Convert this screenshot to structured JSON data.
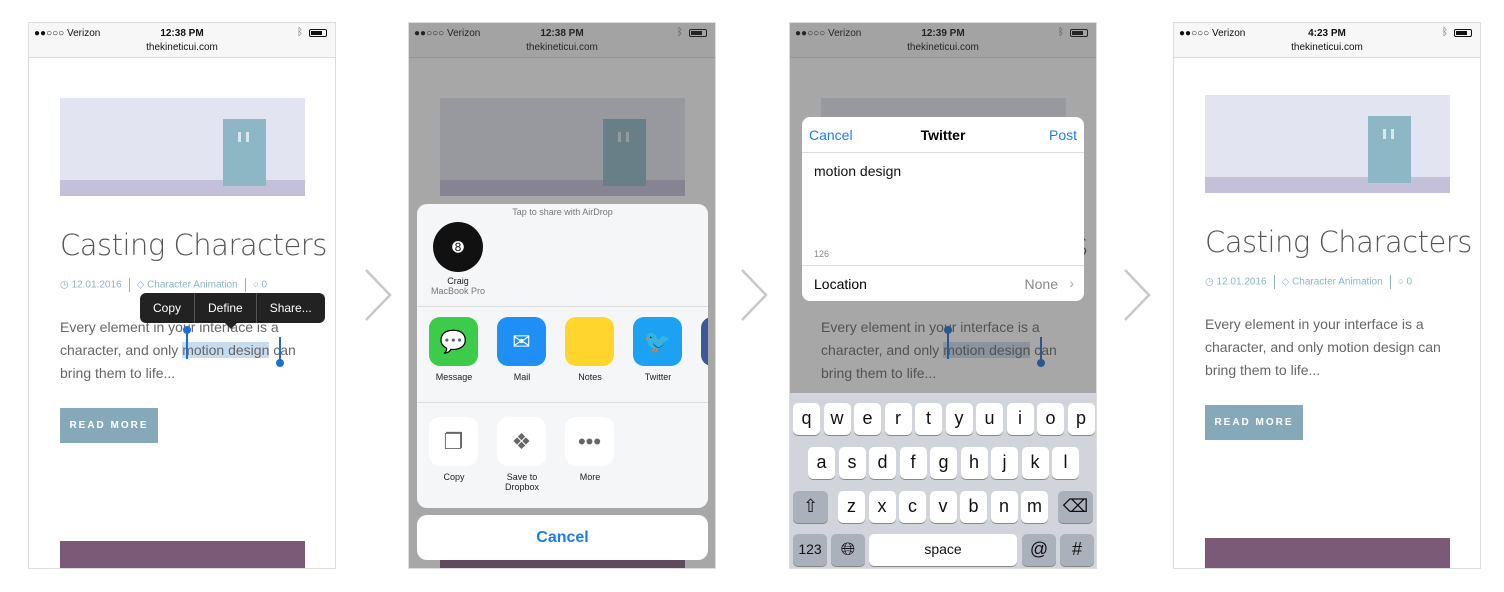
{
  "status": {
    "carrier": "●●○○○ Verizon",
    "time1": "12:38 PM",
    "time3": "12:39 PM",
    "time4": "4:23 PM",
    "url": "thekineticui.com"
  },
  "post": {
    "title": "Casting Characters",
    "date": "12.01.2016",
    "category": "Character Animation",
    "comments": "0",
    "para_before": "Every element in your interface is a character, and only ",
    "para_sel": "motion design",
    "para_after": " can bring them to life...",
    "read_more": "READ MORE"
  },
  "menu": {
    "copy": "Copy",
    "define": "Define",
    "share": "Share..."
  },
  "share": {
    "airdrop_hint": "Tap to share with AirDrop",
    "device_name": "Craig",
    "device_type": "MacBook Pro",
    "apps": [
      {
        "label": "Message",
        "color": "#3ccb4a"
      },
      {
        "label": "Mail",
        "color": "#1f8ef5"
      },
      {
        "label": "Notes",
        "color": "#ffd52e"
      },
      {
        "label": "Twitter",
        "color": "#1da1f2"
      }
    ],
    "actions": [
      {
        "label": "Copy"
      },
      {
        "label": "Save to Dropbox"
      },
      {
        "label": "More"
      }
    ],
    "cancel": "Cancel"
  },
  "twitter": {
    "cancel": "Cancel",
    "title": "Twitter",
    "post": "Post",
    "text": "motion design",
    "count": "126",
    "location_label": "Location",
    "location_value": "None"
  },
  "keyboard": {
    "row1": [
      "q",
      "w",
      "e",
      "r",
      "t",
      "y",
      "u",
      "i",
      "o",
      "p"
    ],
    "row2": [
      "a",
      "s",
      "d",
      "f",
      "g",
      "h",
      "j",
      "k",
      "l"
    ],
    "row3": [
      "z",
      "x",
      "c",
      "v",
      "b",
      "n",
      "m"
    ],
    "num": "123",
    "space": "space",
    "at": "@",
    "hash": "#"
  },
  "colors": {
    "accent": "#1a7cf5",
    "button": "#86a9b9",
    "meta": "#8ab4c6"
  }
}
